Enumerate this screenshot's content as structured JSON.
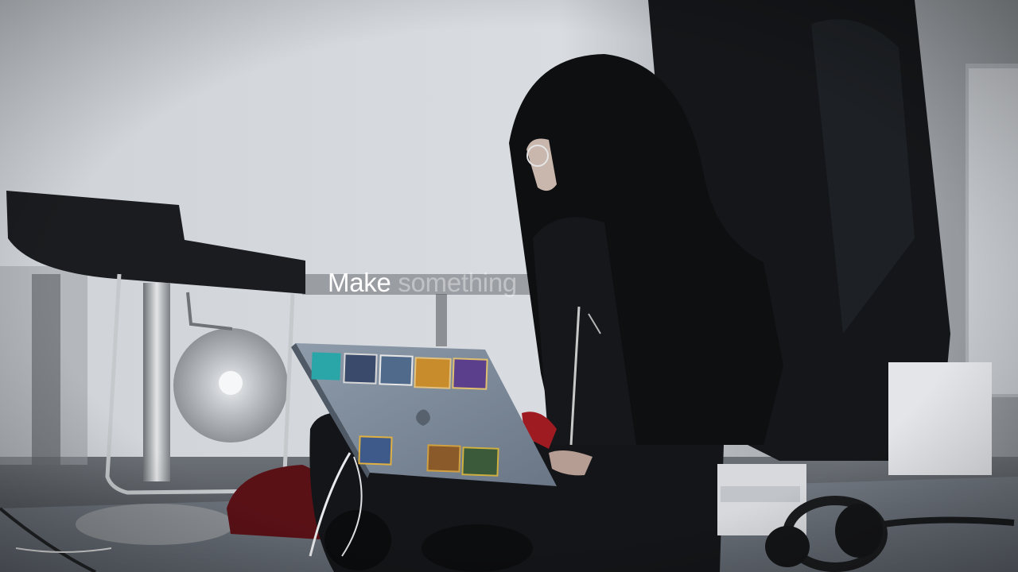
{
  "caption": {
    "word_1": "Make",
    "word_2": "something"
  },
  "colors": {
    "caption_primary": "#ffffff",
    "caption_secondary": "rgba(245,245,245,0.42)",
    "wall": "#d3d6db",
    "floor": "#4f555b"
  }
}
